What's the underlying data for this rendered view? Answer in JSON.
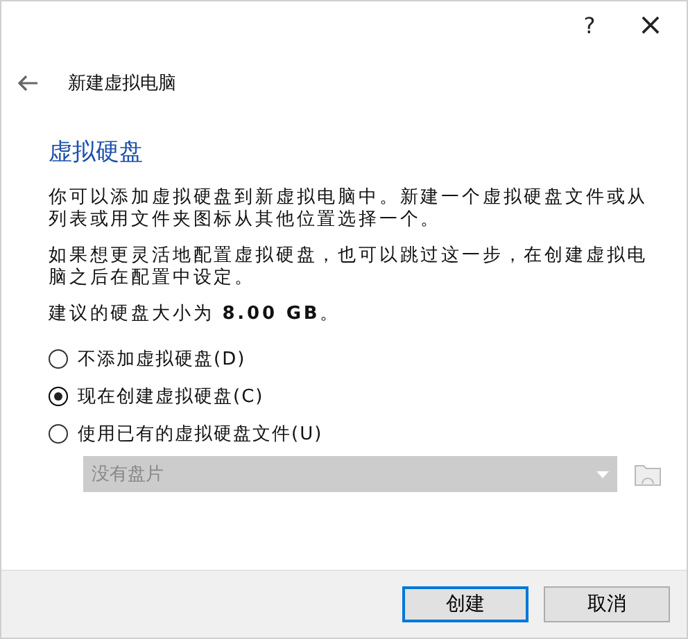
{
  "window": {
    "help": "?",
    "close": "×"
  },
  "header": {
    "title": "新建虚拟电脑"
  },
  "page": {
    "title": "虚拟硬盘",
    "paragraphs": [
      "你可以添加虚拟硬盘到新虚拟电脑中。新建一个虚拟硬盘文件或从列表或用文件夹图标从其他位置选择一个。",
      "如果想更灵活地配置虚拟硬盘，也可以跳过这一步，在创建虚拟电脑之后在配置中设定。",
      "建议的硬盘大小为 **8.00 GB**。"
    ]
  },
  "options": [
    {
      "label": "不添加虚拟硬盘(D)",
      "selected": false
    },
    {
      "label": "现在创建虚拟硬盘(C)",
      "selected": true
    },
    {
      "label": "使用已有的虚拟硬盘文件(U)",
      "selected": false
    }
  ],
  "disk_combo": {
    "value": "没有盘片",
    "disabled": true
  },
  "buttons": [
    {
      "label": "创建",
      "default": true
    },
    {
      "label": "取消",
      "default": false
    }
  ]
}
